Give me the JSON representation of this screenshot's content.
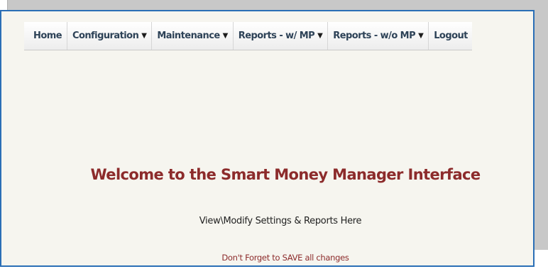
{
  "nav": {
    "items": [
      {
        "label": "Home",
        "has_dropdown": false
      },
      {
        "label": "Configuration",
        "has_dropdown": true
      },
      {
        "label": "Maintenance",
        "has_dropdown": true
      },
      {
        "label": "Reports - w/ MP",
        "has_dropdown": true
      },
      {
        "label": "Reports - w/o MP",
        "has_dropdown": true
      },
      {
        "label": "Logout",
        "has_dropdown": false
      }
    ],
    "caret_glyph": "▼"
  },
  "main": {
    "welcome": "Welcome to the Smart Money Manager Interface",
    "subtitle": "View\\Modify Settings & Reports Here",
    "reminder": "Don't Forget to SAVE all changes"
  },
  "colors": {
    "frame_border": "#2b6fb6",
    "content_bg": "#f6f5ef",
    "nav_text": "#2d4257",
    "accent_text": "#8c2b2b"
  }
}
